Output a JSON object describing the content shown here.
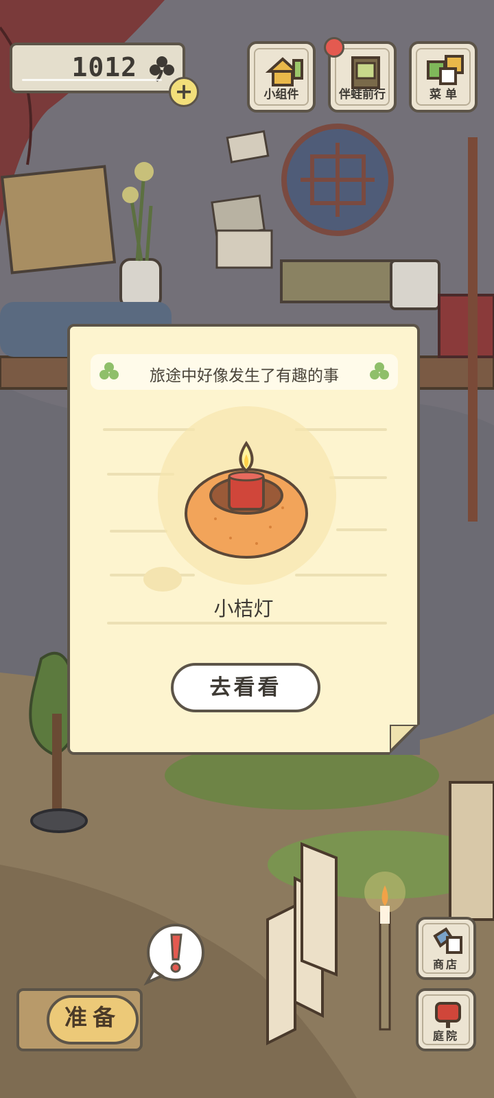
{
  "hud": {
    "clover_count": "1012",
    "clover_icon": "clover-icon",
    "add_label": "+",
    "widgets_label": "小组件",
    "travel_label": "伴蛙前行",
    "menu_label": "菜 单"
  },
  "popup": {
    "banner_text": "旅途中好像发生了有趣的事",
    "item_name": "小桔灯",
    "go_label": "去看看",
    "item_icon": "orange-lantern-icon"
  },
  "bottom": {
    "prepare_label": "准备",
    "alert_icon": "exclamation-icon",
    "shop_label": "商店",
    "yard_label": "庭院"
  },
  "colors": {
    "outline": "#5c5448",
    "card": "#fdf4cf",
    "clover_green": "#8fbf6a",
    "alert_red": "#e45a50"
  }
}
